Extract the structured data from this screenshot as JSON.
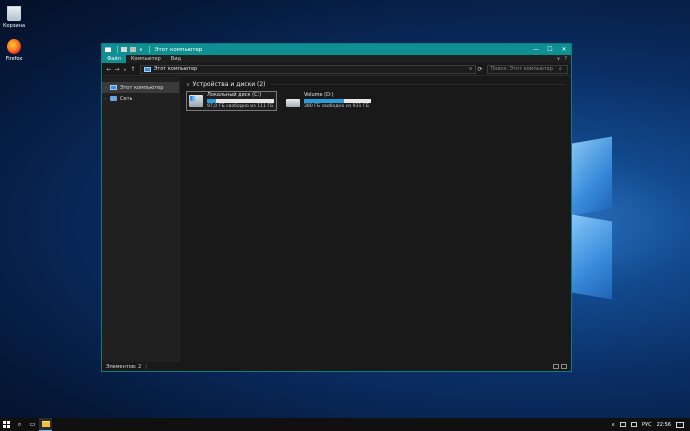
{
  "desktop": {
    "icons": [
      {
        "label": "Корзина",
        "icon": "recycle-bin-icon"
      },
      {
        "label": "Firefox",
        "icon": "firefox-icon"
      }
    ]
  },
  "window": {
    "title": "Этот компьютер",
    "qat_arrow": "∨",
    "controls": {
      "minimize": "—",
      "maximize": "☐",
      "close": "✕"
    },
    "ribbon": {
      "tabs": [
        "Файл",
        "Компьютер",
        "Вид"
      ],
      "collapse": "∨",
      "help": "?"
    },
    "address": {
      "path": "Этот компьютер",
      "search_placeholder": "Поиск: Этот компьютер"
    },
    "nav": {
      "back": "←",
      "forward": "→",
      "recent": "∨",
      "up": "↑",
      "refresh": "⟳",
      "dropdown": "∨",
      "search_glyph": "⌕"
    },
    "sidebar": {
      "items": [
        {
          "label": "Этот компьютер",
          "selected": true,
          "icon": "computer-icon"
        },
        {
          "label": "Сеть",
          "selected": false,
          "icon": "network-icon"
        }
      ],
      "chevron": "›"
    },
    "group": {
      "title": "Устройства и диски (2)",
      "chevron": "∨"
    },
    "drives": [
      {
        "name": "Локальный диск (C:)",
        "free": "97,0 ГБ свободно из 111 ГБ",
        "used_fraction": 0.13,
        "icon": "system-drive-icon"
      },
      {
        "name": "Volume (D:)",
        "free": "380 ГБ свободно из 931 ГБ",
        "used_fraction": 0.59,
        "icon": "drive-icon"
      }
    ],
    "status": {
      "items_count": "Элементов: 2",
      "separator": "|"
    }
  },
  "taskbar": {
    "search_glyph": "⌕",
    "taskview_glyph": "▭",
    "tray": {
      "language": "РУС",
      "time": "22:56",
      "chevron": "∧"
    }
  },
  "colors": {
    "accent": "#0e8f92",
    "progress": "#26a0da",
    "window_bg": "#191919"
  }
}
